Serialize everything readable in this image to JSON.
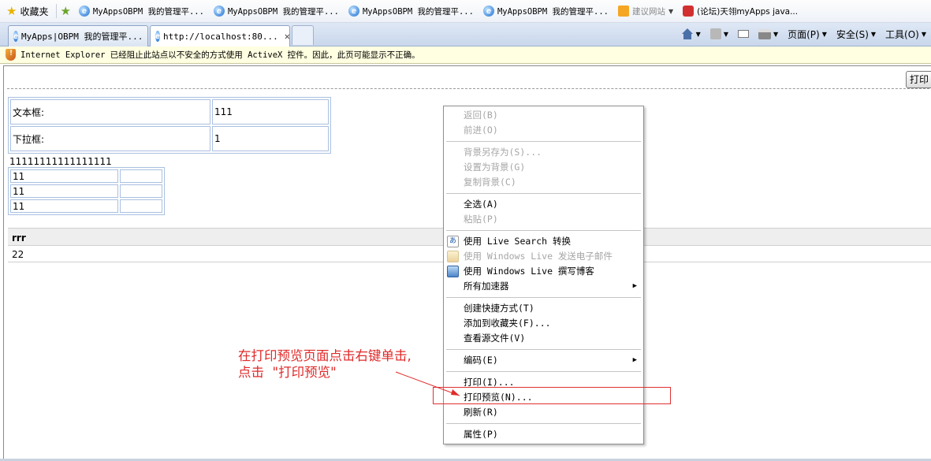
{
  "favorites_bar": {
    "root_label": "收藏夹",
    "items": [
      {
        "label": "MyAppsOBPM 我的管理平..."
      },
      {
        "label": "MyAppsOBPM 我的管理平..."
      },
      {
        "label": "MyAppsOBPM 我的管理平..."
      },
      {
        "label": "MyAppsOBPM 我的管理平..."
      },
      {
        "label": "建议网站"
      },
      {
        "label": "(论坛)天翎myApps java..."
      }
    ]
  },
  "tabs": [
    {
      "label": "MyApps|OBPM 我的管理平..."
    },
    {
      "label": "http://localhost:80..."
    }
  ],
  "command_bar": {
    "page": "页面(P)",
    "safety": "安全(S)",
    "tools": "工具(O)"
  },
  "info_bar": {
    "text": "Internet Explorer 已经阻止此站点以不安全的方式使用 ActiveX 控件。因此，此页可能显示不正确。"
  },
  "page": {
    "print_button": "打印",
    "form": [
      {
        "label": "文本框:",
        "value": "111"
      },
      {
        "label": "下拉框:",
        "value": "1"
      }
    ],
    "long_text": "11111111111111111",
    "subtable": [
      "11",
      "11",
      "11"
    ],
    "grid": {
      "header": "rrr",
      "row": "22"
    }
  },
  "context_menu": {
    "back": "返回(B)",
    "forward": "前进(O)",
    "save_background": "背景另存为(S)...",
    "set_background": "设置为背景(G)",
    "copy_background": "复制背景(C)",
    "select_all": "全选(A)",
    "paste": "粘贴(P)",
    "live_search": "使用 Live Search 转换",
    "live_mail": "使用 Windows Live 发送电子邮件",
    "live_blog": "使用 Windows Live 撰写博客",
    "accelerators": "所有加速器",
    "create_shortcut": "创建快捷方式(T)",
    "add_favorites": "添加到收藏夹(F)...",
    "view_source": "查看源文件(V)",
    "encoding": "编码(E)",
    "print": "打印(I)...",
    "print_preview": "打印预览(N)...",
    "refresh": "刷新(R)",
    "properties": "属性(P)"
  },
  "annotation": {
    "line1": "在打印预览页面点击右键单击,",
    "line2": "点击  \"打印预览\""
  },
  "colors": {
    "annotation_red": "#e02a2a",
    "info_bar_bg": "#ffffe1"
  }
}
